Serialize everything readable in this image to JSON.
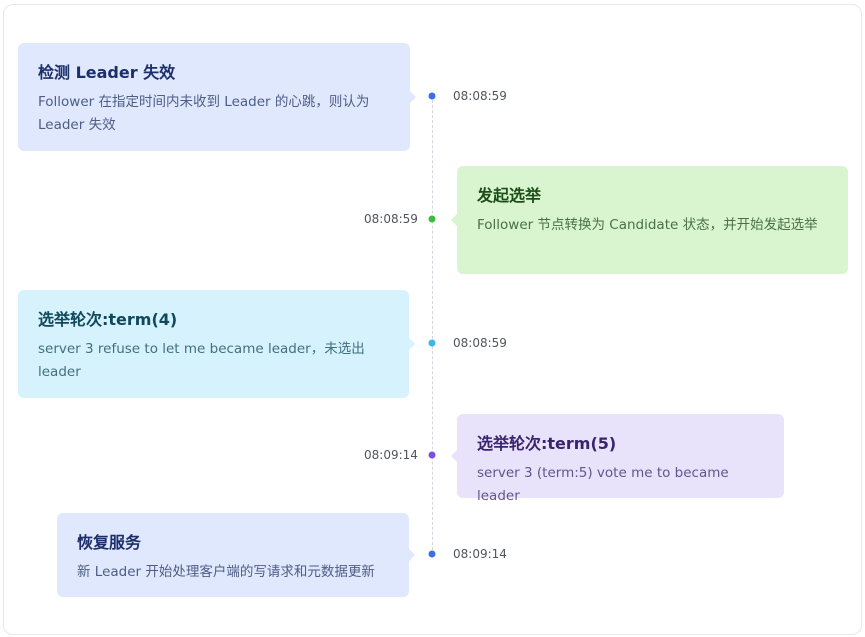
{
  "colors": {
    "blue": "#3b6fe3",
    "green": "#3fbd3a",
    "cyan": "#3ab8e6",
    "purple": "#7c4fe0"
  },
  "events": [
    {
      "title": "检测 Leader 失效",
      "desc": "Follower 在指定时间内未收到 Leader 的心跳，则认为 Leader 失效",
      "time": "08:08:59",
      "color": "blue"
    },
    {
      "title": "发起选举",
      "desc": "Follower 节点转换为 Candidate 状态，并开始发起选举",
      "time": "08:08:59",
      "color": "green"
    },
    {
      "title": "选举轮次:term(4)",
      "desc": "server 3 refuse to let me became leader，未选出 leader",
      "time": "08:08:59",
      "color": "cyan"
    },
    {
      "title": "选举轮次:term(5)",
      "desc": "server 3 (term:5) vote me to became leader",
      "time": "08:09:14",
      "color": "purple"
    },
    {
      "title": "恢复服务",
      "desc": "新 Leader 开始处理客户端的写请求和元数据更新",
      "time": "08:09:14",
      "color": "blue"
    }
  ]
}
